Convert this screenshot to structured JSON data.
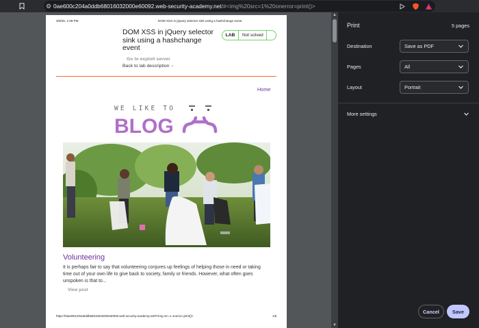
{
  "browser": {
    "url_host": "0ae600c204a0ddb68016032000e60092.web-security-academy.net",
    "url_path": "/#<img%20src=1%20onerror=print()>"
  },
  "page": {
    "header_date": "3/9/26, 1:09 PM",
    "header_title": "DOM XSS in jQuery selector sink using a hashchange event",
    "lab_title": "DOM XSS in jQuery selector sink using a hashchange event",
    "lab_badge": "LAB",
    "lab_status": "Not solved",
    "exploit_server": "Go to exploit server",
    "back_link": "Back to lab description",
    "back_chevron": "»",
    "home_link": "Home",
    "logo_small": "WE LIKE TO",
    "logo_big": "BLOG",
    "post_title": "Volunteering",
    "post_body": "It is perhaps fair to say that volunteering conjures up feelings of helping those in need or taking time out of your own life to give back to society, family or friends. However, what often goes unspoken is that to...",
    "view_post": "View post",
    "footer_url": "https://0ae600c204a0ddb68016032000e60092.web-security-academy.net/#<img src=1 onerror=print()>",
    "footer_page": "1/5"
  },
  "print_panel": {
    "title": "Print",
    "page_count": "5 pages",
    "destination_label": "Destination",
    "destination_value": "Save as PDF",
    "pages_label": "Pages",
    "pages_value": "All",
    "layout_label": "Layout",
    "layout_value": "Portrait",
    "more_settings": "More settings",
    "cancel": "Cancel",
    "save": "Save"
  },
  "colors": {
    "accent": "#c2c8ff",
    "blog_purple": "#b06fc9",
    "link_purple": "#6e2f9c",
    "lab_green": "#70d16d",
    "divider_orange": "#ff6633"
  },
  "icons": [
    "bookmark-icon",
    "tune-icon",
    "share-icon",
    "brave-shield-icon",
    "brave-rewards-icon",
    "chevron-down-icon"
  ]
}
